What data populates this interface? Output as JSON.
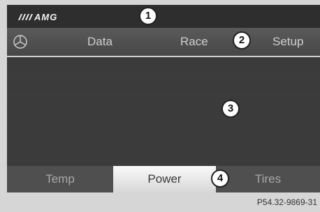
{
  "brand": {
    "logo": "AMG"
  },
  "menu": {
    "data_label": "Data",
    "race_label": "Race",
    "setup_label": "Setup"
  },
  "tabs": {
    "temp_label": "Temp",
    "power_label": "Power",
    "tires_label": "Tires",
    "active": "Power"
  },
  "callouts": [
    "1",
    "2",
    "3",
    "4"
  ],
  "figure_ref": "P54.32-9869-31"
}
